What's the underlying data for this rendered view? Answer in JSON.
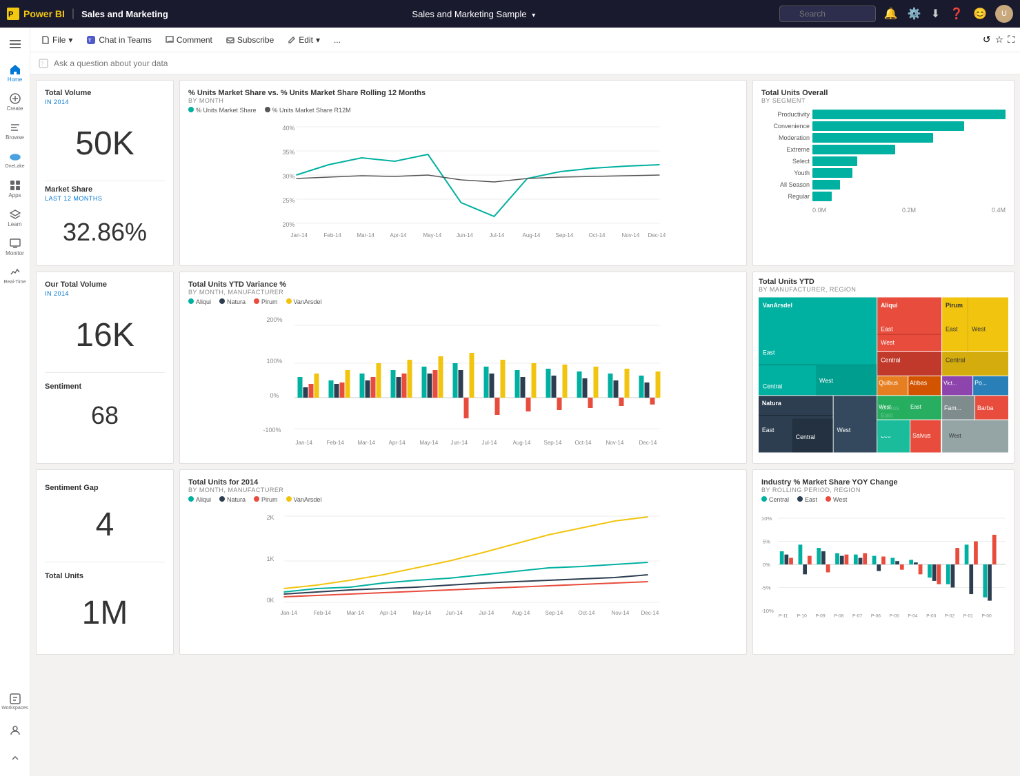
{
  "app": {
    "name": "Power BI",
    "section": "Sales and Marketing",
    "report_title": "Sales and Marketing Sample"
  },
  "toolbar": {
    "file_label": "File",
    "chat_label": "Chat in Teams",
    "comment_label": "Comment",
    "subscribe_label": "Subscribe",
    "edit_label": "Edit",
    "more_label": "..."
  },
  "search": {
    "placeholder": "Search"
  },
  "qa": {
    "placeholder": "Ask a question about your data"
  },
  "sidebar": {
    "items": [
      {
        "id": "home",
        "label": "Home"
      },
      {
        "id": "create",
        "label": "Create"
      },
      {
        "id": "browse",
        "label": "Browse"
      },
      {
        "id": "datalake",
        "label": "OneLake"
      },
      {
        "id": "apps",
        "label": "Apps"
      },
      {
        "id": "learn",
        "label": "Learn"
      },
      {
        "id": "monitor",
        "label": "Monitor"
      },
      {
        "id": "realtime",
        "label": "Real-Time"
      },
      {
        "id": "workspaces",
        "label": "Workspaces"
      }
    ]
  },
  "cards": {
    "total_volume": {
      "title": "Total Volume",
      "subtitle": "IN 2014",
      "value": "50K"
    },
    "market_share": {
      "title": "Market Share",
      "subtitle": "LAST 12 MONTHS",
      "value": "32.86%"
    },
    "our_total_volume": {
      "title": "Our Total Volume",
      "subtitle": "IN 2014",
      "value": "16K"
    },
    "sentiment": {
      "label": "Sentiment",
      "value": "68"
    },
    "sentiment_gap": {
      "label": "Sentiment Gap",
      "value": "4"
    },
    "total_units": {
      "label": "Total Units",
      "value": "1M"
    }
  },
  "charts": {
    "market_share_line": {
      "title": "% Units Market Share vs. % Units Market Share Rolling 12 Months",
      "subtitle": "BY MONTH",
      "legend": [
        "% Units Market Share",
        "% Units Market Share R12M"
      ],
      "y_labels": [
        "40%",
        "35%",
        "30%",
        "25%",
        "20%"
      ],
      "x_labels": [
        "Jan-14",
        "Feb-14",
        "Mar-14",
        "Apr-14",
        "May-14",
        "Jun-14",
        "Jul-14",
        "Aug-14",
        "Sep-14",
        "Oct-14",
        "Nov-14",
        "Dec-14"
      ]
    },
    "total_units_overall": {
      "title": "Total Units Overall",
      "subtitle": "BY SEGMENT",
      "segments": [
        {
          "name": "Productivity",
          "value": 0.95
        },
        {
          "name": "Convenience",
          "value": 0.75
        },
        {
          "name": "Moderation",
          "value": 0.6
        },
        {
          "name": "Extreme",
          "value": 0.42
        },
        {
          "name": "Select",
          "value": 0.22
        },
        {
          "name": "Youth",
          "value": 0.2
        },
        {
          "name": "All Season",
          "value": 0.14
        },
        {
          "name": "Regular",
          "value": 0.1
        }
      ],
      "x_labels": [
        "0.0M",
        "0.2M",
        "0.4M"
      ]
    },
    "ytd_variance": {
      "title": "Total Units YTD Variance %",
      "subtitle": "BY MONTH, MANUFACTURER",
      "legend": [
        "Aliqui",
        "Natura",
        "Pirum",
        "VanArsdel"
      ],
      "y_labels": [
        "200%",
        "100%",
        "0%",
        "-100%"
      ]
    },
    "ytd_treemap": {
      "title": "Total Units YTD",
      "subtitle": "BY MANUFACTURER, REGION",
      "items": [
        {
          "name": "VanArsdel",
          "region": "",
          "color": "#00b0a0",
          "size": "large"
        },
        {
          "name": "Aliqui",
          "region": "",
          "color": "#e74c3c",
          "size": "medium"
        },
        {
          "name": "Pirum",
          "region": "",
          "color": "#f1c40f",
          "size": "medium"
        },
        {
          "name": "Natura",
          "region": "",
          "color": "#2c3e50",
          "size": "medium"
        }
      ]
    },
    "total_units_2014": {
      "title": "Total Units for 2014",
      "subtitle": "BY MONTH, MANUFACTURER",
      "legend": [
        "Aliqui",
        "Natura",
        "Pirum",
        "VanArsdel"
      ]
    },
    "industry_market_share": {
      "title": "Industry % Market Share YOY Change",
      "subtitle": "BY ROLLING PERIOD, REGION",
      "legend": [
        "Central",
        "East",
        "West"
      ],
      "y_labels": [
        "10%",
        "5%",
        "0%",
        "-5%",
        "-10%"
      ],
      "x_labels": [
        "P-11",
        "P-10",
        "P-09",
        "P-08",
        "P-07",
        "P-06",
        "P-05",
        "P-04",
        "P-03",
        "P-02",
        "P-01",
        "P-00"
      ]
    }
  }
}
